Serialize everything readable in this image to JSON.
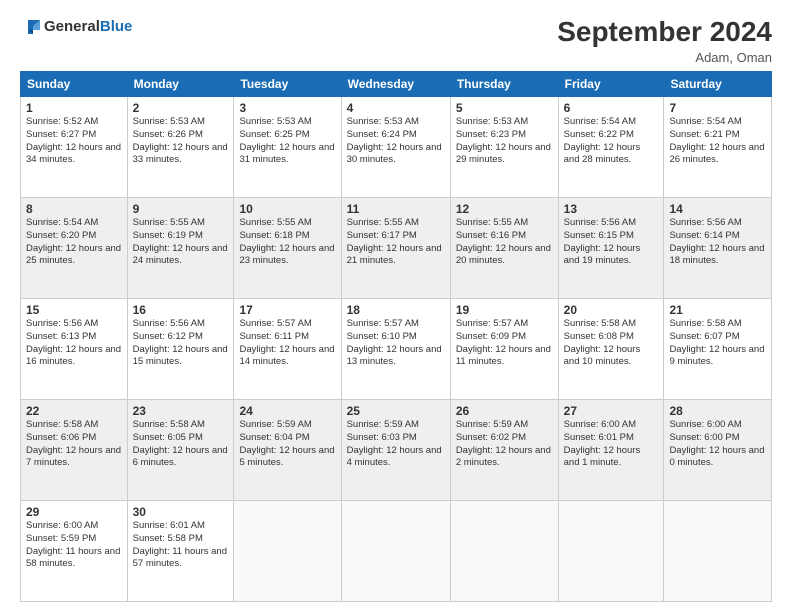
{
  "header": {
    "logo": {
      "text_general": "General",
      "text_blue": "Blue"
    },
    "month_title": "September 2024",
    "location": "Adam, Oman"
  },
  "weekdays": [
    "Sunday",
    "Monday",
    "Tuesday",
    "Wednesday",
    "Thursday",
    "Friday",
    "Saturday"
  ],
  "weeks": [
    [
      {
        "day": "1",
        "sunrise": "5:52 AM",
        "sunset": "6:27 PM",
        "daylight": "12 hours and 34 minutes."
      },
      {
        "day": "2",
        "sunrise": "5:53 AM",
        "sunset": "6:26 PM",
        "daylight": "12 hours and 33 minutes."
      },
      {
        "day": "3",
        "sunrise": "5:53 AM",
        "sunset": "6:25 PM",
        "daylight": "12 hours and 31 minutes."
      },
      {
        "day": "4",
        "sunrise": "5:53 AM",
        "sunset": "6:24 PM",
        "daylight": "12 hours and 30 minutes."
      },
      {
        "day": "5",
        "sunrise": "5:53 AM",
        "sunset": "6:23 PM",
        "daylight": "12 hours and 29 minutes."
      },
      {
        "day": "6",
        "sunrise": "5:54 AM",
        "sunset": "6:22 PM",
        "daylight": "12 hours and 28 minutes."
      },
      {
        "day": "7",
        "sunrise": "5:54 AM",
        "sunset": "6:21 PM",
        "daylight": "12 hours and 26 minutes."
      }
    ],
    [
      {
        "day": "8",
        "sunrise": "5:54 AM",
        "sunset": "6:20 PM",
        "daylight": "12 hours and 25 minutes."
      },
      {
        "day": "9",
        "sunrise": "5:55 AM",
        "sunset": "6:19 PM",
        "daylight": "12 hours and 24 minutes."
      },
      {
        "day": "10",
        "sunrise": "5:55 AM",
        "sunset": "6:18 PM",
        "daylight": "12 hours and 23 minutes."
      },
      {
        "day": "11",
        "sunrise": "5:55 AM",
        "sunset": "6:17 PM",
        "daylight": "12 hours and 21 minutes."
      },
      {
        "day": "12",
        "sunrise": "5:55 AM",
        "sunset": "6:16 PM",
        "daylight": "12 hours and 20 minutes."
      },
      {
        "day": "13",
        "sunrise": "5:56 AM",
        "sunset": "6:15 PM",
        "daylight": "12 hours and 19 minutes."
      },
      {
        "day": "14",
        "sunrise": "5:56 AM",
        "sunset": "6:14 PM",
        "daylight": "12 hours and 18 minutes."
      }
    ],
    [
      {
        "day": "15",
        "sunrise": "5:56 AM",
        "sunset": "6:13 PM",
        "daylight": "12 hours and 16 minutes."
      },
      {
        "day": "16",
        "sunrise": "5:56 AM",
        "sunset": "6:12 PM",
        "daylight": "12 hours and 15 minutes."
      },
      {
        "day": "17",
        "sunrise": "5:57 AM",
        "sunset": "6:11 PM",
        "daylight": "12 hours and 14 minutes."
      },
      {
        "day": "18",
        "sunrise": "5:57 AM",
        "sunset": "6:10 PM",
        "daylight": "12 hours and 13 minutes."
      },
      {
        "day": "19",
        "sunrise": "5:57 AM",
        "sunset": "6:09 PM",
        "daylight": "12 hours and 11 minutes."
      },
      {
        "day": "20",
        "sunrise": "5:58 AM",
        "sunset": "6:08 PM",
        "daylight": "12 hours and 10 minutes."
      },
      {
        "day": "21",
        "sunrise": "5:58 AM",
        "sunset": "6:07 PM",
        "daylight": "12 hours and 9 minutes."
      }
    ],
    [
      {
        "day": "22",
        "sunrise": "5:58 AM",
        "sunset": "6:06 PM",
        "daylight": "12 hours and 7 minutes."
      },
      {
        "day": "23",
        "sunrise": "5:58 AM",
        "sunset": "6:05 PM",
        "daylight": "12 hours and 6 minutes."
      },
      {
        "day": "24",
        "sunrise": "5:59 AM",
        "sunset": "6:04 PM",
        "daylight": "12 hours and 5 minutes."
      },
      {
        "day": "25",
        "sunrise": "5:59 AM",
        "sunset": "6:03 PM",
        "daylight": "12 hours and 4 minutes."
      },
      {
        "day": "26",
        "sunrise": "5:59 AM",
        "sunset": "6:02 PM",
        "daylight": "12 hours and 2 minutes."
      },
      {
        "day": "27",
        "sunrise": "6:00 AM",
        "sunset": "6:01 PM",
        "daylight": "12 hours and 1 minute."
      },
      {
        "day": "28",
        "sunrise": "6:00 AM",
        "sunset": "6:00 PM",
        "daylight": "12 hours and 0 minutes."
      }
    ],
    [
      {
        "day": "29",
        "sunrise": "6:00 AM",
        "sunset": "5:59 PM",
        "daylight": "11 hours and 58 minutes."
      },
      {
        "day": "30",
        "sunrise": "6:01 AM",
        "sunset": "5:58 PM",
        "daylight": "11 hours and 57 minutes."
      },
      null,
      null,
      null,
      null,
      null
    ]
  ],
  "labels": {
    "sunrise": "Sunrise: ",
    "sunset": "Sunset: ",
    "daylight": "Daylight: "
  }
}
